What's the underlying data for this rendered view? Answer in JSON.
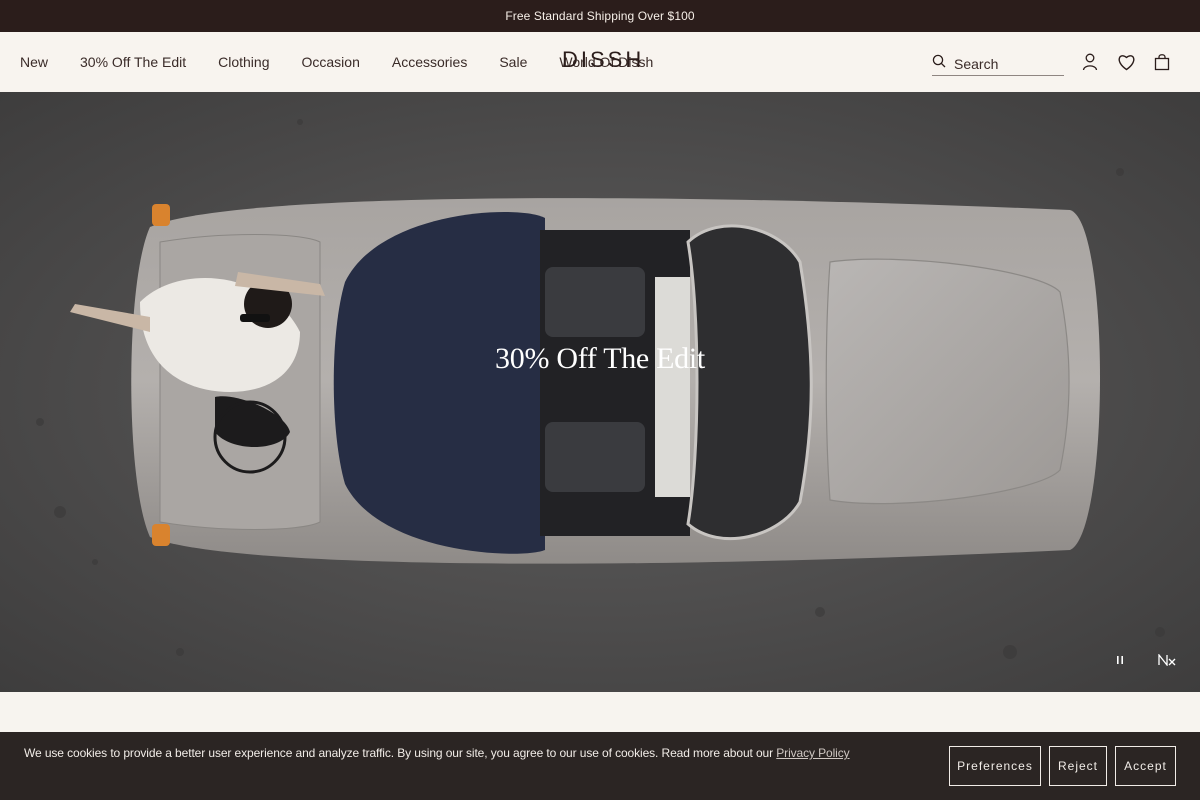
{
  "announcement": "Free Standard Shipping Over $100",
  "brand": "DISSH",
  "nav": [
    "New",
    "30% Off The Edit",
    "Clothing",
    "Occasion",
    "Accessories",
    "Sale",
    "World Of Dissh"
  ],
  "search": {
    "placeholder": "Search"
  },
  "hero": {
    "title": "30% Off The Edit"
  },
  "cookie": {
    "text": "We use cookies to provide a better user experience and analyze traffic. By using our site, you agree to our use of cookies. Read more about our ",
    "link": "Privacy Policy",
    "preferences": "Preferences",
    "reject": "Reject",
    "accept": "Accept"
  },
  "colors": {
    "announcement_bg": "#2b1d1b",
    "header_bg": "#f8f4ef",
    "cookie_bg": "#2b2523"
  }
}
